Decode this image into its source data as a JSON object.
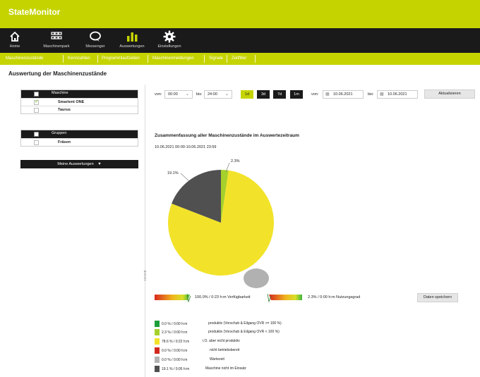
{
  "app": {
    "title": "StateMonitor"
  },
  "nav": [
    {
      "label": "Home",
      "icon": "home-icon"
    },
    {
      "label": "Maschinenpark",
      "icon": "grid-icon"
    },
    {
      "label": "Messenger",
      "icon": "speech-bubble-icon"
    },
    {
      "label": "Auswertungen",
      "icon": "bar-chart-icon"
    },
    {
      "label": "Einstellungen",
      "icon": "gear-icon"
    }
  ],
  "subnav": [
    "Maschinenzustände",
    "Kennzahlen",
    "Programmlaufzeiten",
    "Maschinenmeldungen",
    "Signale",
    "Zeitfilter"
  ],
  "page_title": "Auswertung der Maschinenzustände",
  "machines": {
    "header": "Maschine",
    "rows": [
      {
        "name": "Smartent ONE",
        "checked": true
      },
      {
        "name": "Taurus",
        "checked": false
      }
    ]
  },
  "groups": {
    "header": "Gruppen",
    "rows": [
      {
        "name": "Fräsen",
        "checked": false
      }
    ]
  },
  "my_evaluations": "Meine Auswertungen",
  "filter": {
    "from_label": "von:",
    "from_time": "00:00",
    "to_label": "bis:",
    "to_time": "24:00",
    "ranges": [
      "1d",
      "3d",
      "7d",
      "1m"
    ],
    "active_range": "1d",
    "date_from_label": "von:",
    "date_from": "10.06.2021",
    "date_to_label": "bis:",
    "date_to": "10.06.2021",
    "refresh": "Aktualisieren"
  },
  "summary": {
    "title": "Zusammenfassung aller Maschinenzustände im Auswertezeitraum",
    "range": "10.06.2021 00:00-10.06.2021 23:59"
  },
  "gauges": {
    "availability": "100.0% / 0:23 h:m Verfügbarkeit",
    "utilization": "2.3% / 0:00 h:m Nutzungsgrad"
  },
  "save_button": "Daten speichern",
  "chart_data": {
    "type": "pie",
    "slices": [
      {
        "label": "produktiv (Vorschub & Eilgang OVR >= 100 %)",
        "value": 0.0,
        "time": "0:00",
        "color": "#1e9e3a"
      },
      {
        "label": "produktiv (Vorschub & Eilgang OVR < 100 %)",
        "value": 2.3,
        "time": "0:00",
        "color": "#a6d02b"
      },
      {
        "label": "i.O. aber nicht produktiv",
        "value": 78.6,
        "time": "0:22",
        "color": "#f2e32a"
      },
      {
        "label": "nicht betriebsbereit",
        "value": 0.0,
        "time": "0:00",
        "color": "#d0281e"
      },
      {
        "label": "Wartezeit",
        "value": 0.0,
        "time": "0:00",
        "color": "#b4b4b4"
      },
      {
        "label": "Maschine nicht im Einsatz",
        "value": 19.1,
        "time": "0:05",
        "color": "#505050"
      }
    ],
    "data_labels": [
      "2.3%",
      "19.1%"
    ]
  },
  "legend": [
    {
      "value": "0.0 % / 0:00 h:m",
      "desc": "produktiv (Vorschub & Eilgang OVR >= 100 %)",
      "color": "#1e9e3a"
    },
    {
      "value": "2.3 % / 0:00 h:m",
      "desc": "produktiv (Vorschub & Eilgang OVR < 100 %)",
      "color": "#a6d02b"
    },
    {
      "value": "78.6 % / 0:22 h:m",
      "desc": "i.O. aber nicht produktiv",
      "color": "#f2e32a"
    },
    {
      "value": "0.0 % / 0:00 h:m",
      "desc": "nicht betriebsbereit",
      "color": "#d0281e"
    },
    {
      "value": "0.0 % / 0:00 h:m",
      "desc": "Wartezeit",
      "color": "#b4b4b4"
    },
    {
      "value": "19.1 % / 0:05 h:m",
      "desc": "Maschine nicht im Einsatz",
      "color": "#505050"
    }
  ]
}
